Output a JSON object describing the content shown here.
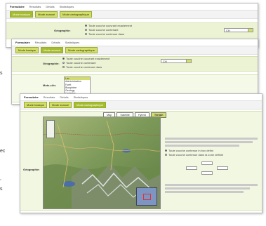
{
  "cut_text": [
    "s",
    "ec",
    ",",
    "s"
  ],
  "tab_labels": [
    "Formulaire",
    "Résultats",
    "Détails",
    "Statistiques"
  ],
  "search_buttons": [
    "Mode basique",
    "Mode avancé",
    "Mode cartographique"
  ],
  "geo_label": "Géographie:",
  "geo_options": [
    "Toute couche couvrant exactement",
    "Toute couche contenant",
    "Toute couche contenue dans"
  ],
  "region_select": "CH",
  "keywords_label": "Mots-clés",
  "keywords_list": [
    "Lac",
    "Administration",
    "Forêt",
    "Biosphère",
    "Geology",
    "Cadastre"
  ],
  "panel3_buttons": [
    "Mode basique",
    "Mode avancé",
    "Mode cartographique"
  ],
  "map_tabs": [
    "Map",
    "Satellite",
    "Hybrid",
    "Terrain"
  ],
  "map_radio_options": [
    "Toute couche contenue in box défini",
    "Toute couche contenue dans la zone définie"
  ],
  "colors": {
    "accent": "#d3de6a",
    "accent_dark": "#a6bc2f",
    "band": "#ebf3d4",
    "map_terrain": "#7b9b5c"
  },
  "icons": [
    "radio-button",
    "dropdown-arrow",
    "map-zoom-control",
    "map-overview"
  ]
}
